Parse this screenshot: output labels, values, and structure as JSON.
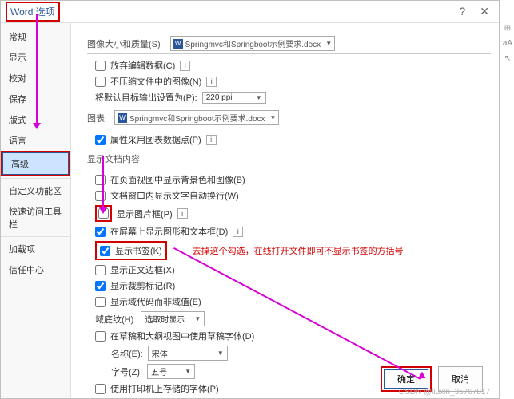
{
  "title": "Word 选项",
  "sidebar": {
    "items": [
      "常规",
      "显示",
      "校对",
      "保存",
      "版式",
      "语言",
      "高级",
      "自定义功能区",
      "快速访问工具栏",
      "加载项",
      "信任中心"
    ],
    "selected_index": 6
  },
  "sections": {
    "image_size": {
      "label": "图像大小和质量(S)",
      "doc": "Springmvc和Springboot示例要求.docx",
      "discard_edit": "放弃编辑数据(C)",
      "no_compress": "不压缩文件中的图像(N)",
      "default_target_label": "将默认目标输出设置为(P):",
      "default_target_value": "220 ppi"
    },
    "chart": {
      "label": "图表",
      "doc": "Springmvc和Springboot示例要求.docx",
      "prop_datapoint": "属性采用图表数据点(P)"
    },
    "doc_content": {
      "label": "显示文档内容",
      "bg_color": "在页面视图中显示背景色和图像(B)",
      "auto_wrap": "文档窗口内显示文字自动换行(W)",
      "pic_frame": "显示图片框(P)",
      "shape_text": "在屏幕上显示图形和文本框(D)",
      "bookmark": "显示书签(K)",
      "body_border": "显示正文边框(X)",
      "crop_mark": "显示裁剪标记(R)",
      "field_code": "显示域代码而非域值(E)",
      "field_shading_label": "域底纹(H):",
      "field_shading_value": "选取时显示",
      "draft_font": "在草稿和大纲视图中使用草稿字体(D)",
      "font_name_label": "名称(E):",
      "font_name_value": "宋体",
      "font_size_label": "字号(Z):",
      "font_size_value": "五号",
      "printer_font": "使用打印机上存储的字体(P)"
    }
  },
  "checkbox_states": {
    "discard_edit": false,
    "no_compress": false,
    "prop_datapoint": true,
    "bg_color": false,
    "auto_wrap": false,
    "pic_frame": false,
    "shape_text": true,
    "bookmark": true,
    "body_border": false,
    "crop_mark": true,
    "field_code": false,
    "draft_font": false,
    "printer_font": false
  },
  "annotation": "去掉这个勾选，在线打开文件即可不显示书签的方括号",
  "buttons": {
    "ok": "确定",
    "cancel": "取消"
  },
  "watermark": "CSDN @liuxin_35767817"
}
